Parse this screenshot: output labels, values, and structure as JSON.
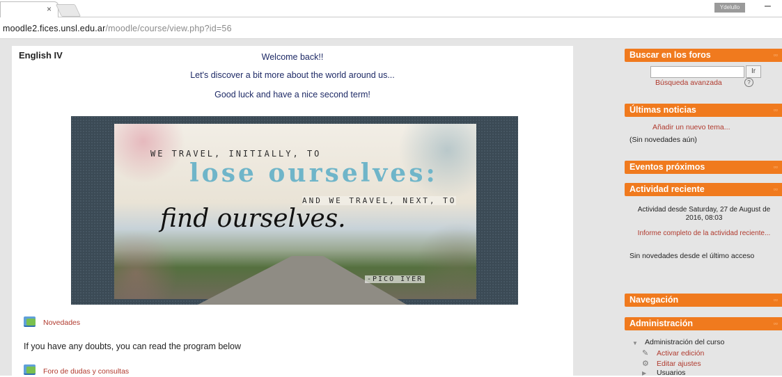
{
  "browser": {
    "url_host": "moodle2.fices.unsl.edu.ar",
    "url_path": "/moodle/course/view.php?id=56",
    "tab_close": "×",
    "user_chip": "Ydelullo",
    "minimize": "–"
  },
  "course": {
    "title": "English IV",
    "welcome": "Welcome back!!",
    "discover": "Let's discover a bit more about the world around us...",
    "goodluck": "Good luck and have a nice second term!"
  },
  "banner": {
    "line1": "WE TRAVEL, INITIALLY, TO",
    "line2": "lose ourselves:",
    "line3": "AND WE TRAVEL, NEXT, TO",
    "line4": "find ourselves.",
    "author": "-PICO IYER"
  },
  "activities": {
    "novedades": "Novedades",
    "doubts": "If you have any doubts, you can read the program below",
    "foro": "Foro de dudas y consultas"
  },
  "blocks": {
    "buscar": {
      "title": "Buscar en los foros",
      "button": "Ir",
      "advanced": "Búsqueda avanzada",
      "help": "?"
    },
    "noticias": {
      "title": "Últimas noticias",
      "add": "Añadir un nuevo tema...",
      "empty": "(Sin novedades aún)"
    },
    "eventos": {
      "title": "Eventos próximos"
    },
    "actividad": {
      "title": "Actividad reciente",
      "since": "Actividad desde Saturday, 27 de August de 2016, 08:03",
      "report": "Informe completo de la actividad reciente...",
      "empty": "Sin novedades desde el último acceso"
    },
    "navegacion": {
      "title": "Navegación"
    },
    "administracion": {
      "title": "Administración",
      "course_admin": "Administración del curso",
      "activar": "Activar edición",
      "editar": "Editar ajustes",
      "usuarios": "Usuarios"
    },
    "control_glyph": "▫▫"
  },
  "colors": {
    "block_header": "#f07a1e",
    "link": "#b03a2e",
    "text_blue": "#1e2a66"
  }
}
